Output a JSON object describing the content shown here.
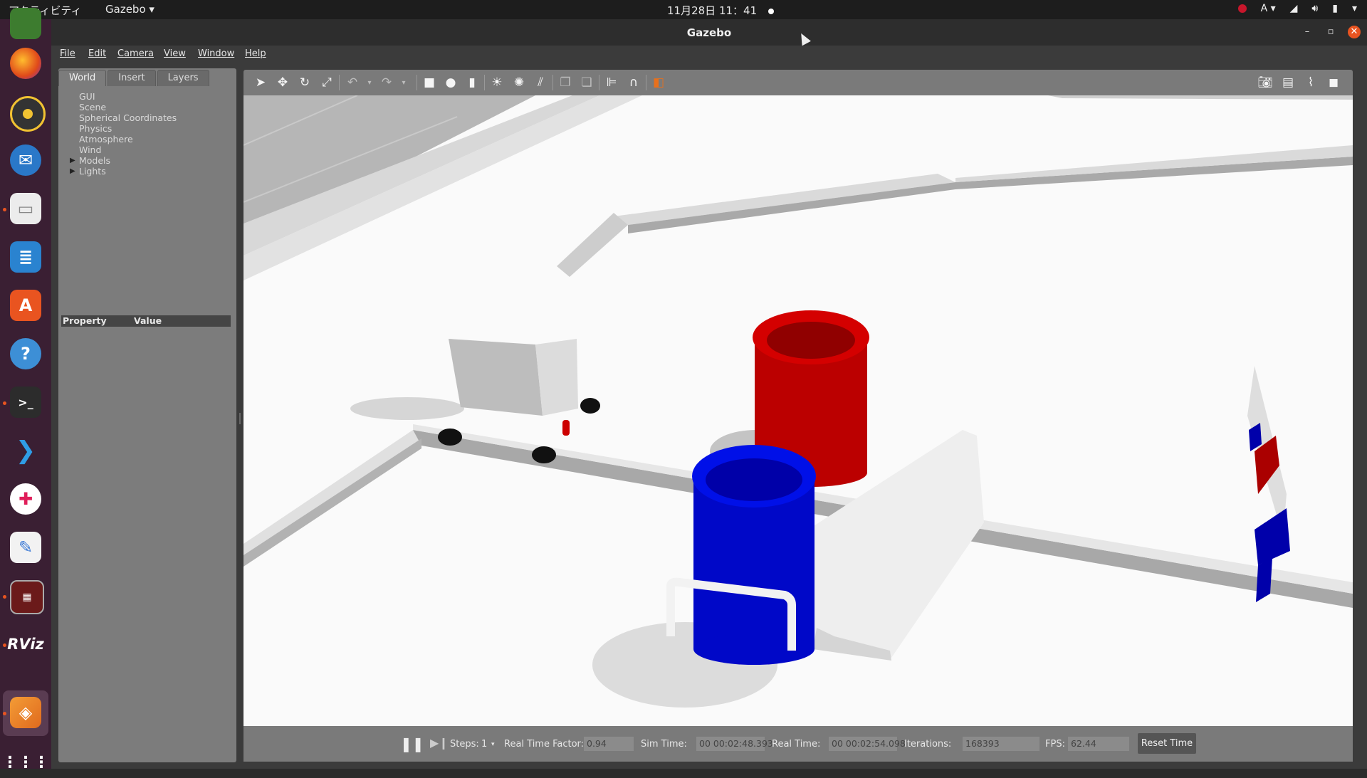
{
  "topbar": {
    "activities": "アクティビティ",
    "app_menu": "Gazebo ▾",
    "clock": "11月28日  11：41",
    "input_method": "A ▾"
  },
  "window": {
    "title": "Gazebo",
    "minimize": "–",
    "maximize": "▫",
    "close": "✕"
  },
  "menubar": {
    "items": [
      "File",
      "Edit",
      "Camera",
      "View",
      "Window",
      "Help"
    ]
  },
  "left_panel": {
    "tabs": [
      "World",
      "Insert",
      "Layers"
    ],
    "active_tab": "World",
    "tree": [
      "GUI",
      "Scene",
      "Spherical Coordinates",
      "Physics",
      "Atmosphere",
      "Wind",
      "Models",
      "Lights"
    ],
    "expandable": [
      "Models",
      "Lights"
    ],
    "property_header": "Property",
    "value_header": "Value"
  },
  "toolbar": {
    "tools": [
      "select-arrow-icon",
      "translate-icon",
      "rotate-icon",
      "scale-icon",
      "undo-icon",
      "undo-dropdown-icon",
      "redo-icon",
      "redo-dropdown-icon",
      "box-icon",
      "sphere-icon",
      "cylinder-icon",
      "point-light-icon",
      "spot-light-icon",
      "directional-light-icon",
      "copy-icon",
      "paste-icon",
      "align-icon",
      "snap-icon",
      "change-view-icon",
      "screenshot-icon",
      "log-icon",
      "plot-icon",
      "record-video-icon"
    ]
  },
  "bottombar": {
    "pause_icon": "pause-icon",
    "step_icon": "step-icon",
    "steps_label": "Steps:",
    "steps_value": "1",
    "rtf_label": "Real Time Factor:",
    "rtf_value": "0.94",
    "sim_time_label": "Sim Time:",
    "sim_time_value": "00 00:02:48.393",
    "real_time_label": "Real Time:",
    "real_time_value": "00 00:02:54.098",
    "iterations_label": "Iterations:",
    "iterations_value": "168393",
    "fps_label": "FPS:",
    "fps_value": "62.44",
    "reset_button": "Reset Time"
  },
  "dock": {
    "apps": [
      "firefox",
      "rhythmbox",
      "thunderbird",
      "files",
      "libreoffice-writer",
      "software",
      "help",
      "terminal",
      "vscode",
      "slack",
      "text-editor",
      "mission-monitor",
      "rviz",
      "gazebo",
      "show-apps"
    ],
    "rviz_label": "RViz"
  },
  "colors": {
    "red_bin": "#c00000",
    "blue_bin": "#0000cc",
    "accent": "#e95420"
  }
}
